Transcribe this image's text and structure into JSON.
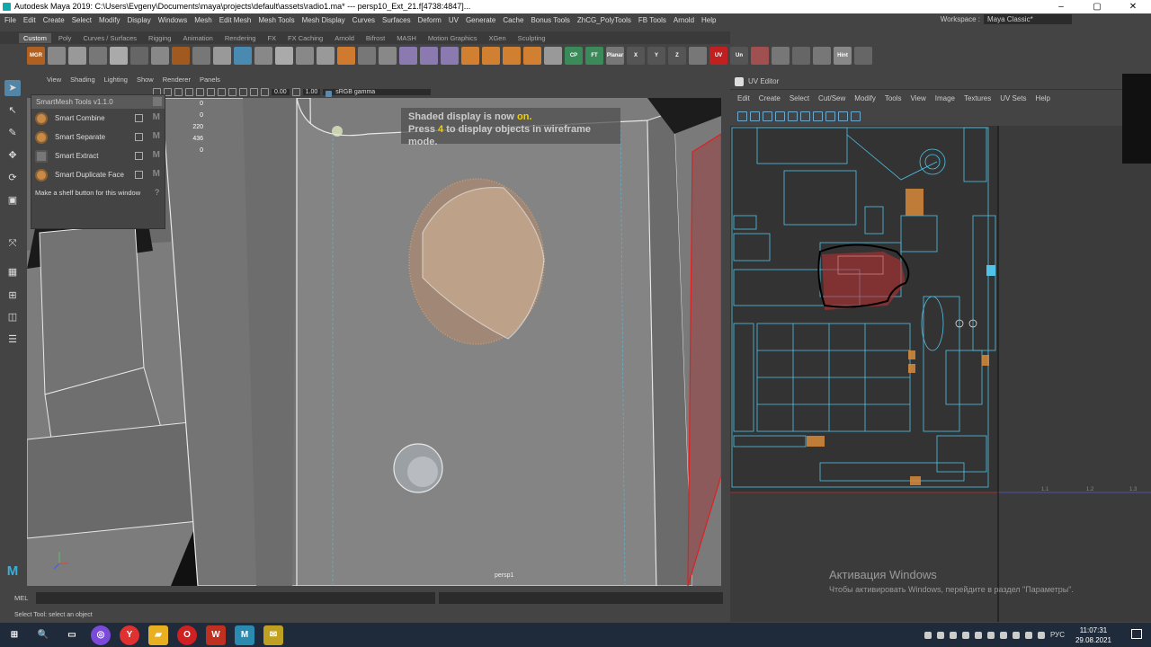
{
  "window": {
    "title": "Autodesk Maya 2019: C:\\Users\\Evgeny\\Documents\\maya\\projects\\default\\assets\\radio1.ma*  ---  persp10_Ext_21.f[4738:4847]...",
    "controls": [
      "–",
      "▢",
      "✕"
    ]
  },
  "main_menu": [
    "File",
    "Edit",
    "Create",
    "Select",
    "Modify",
    "Display",
    "Windows",
    "Mesh",
    "Edit Mesh",
    "Mesh Tools",
    "Mesh Display",
    "Curves",
    "Surfaces",
    "Deform",
    "UV",
    "Generate",
    "Cache",
    "Bonus Tools",
    "ZhCG_PolyTools",
    "FB Tools",
    "Arnold",
    "Help"
  ],
  "workspace": {
    "label": "Workspace :",
    "value": "Maya Classic*"
  },
  "shelf_tabs": [
    "Custom",
    "Poly",
    "Curves / Surfaces",
    "Rigging",
    "Animation",
    "Rendering",
    "FX",
    "FX Caching",
    "Arnold",
    "Bifrost",
    "MASH",
    "Motion Graphics",
    "XGen",
    "Sculpting"
  ],
  "shelf_buttons": [
    "MGR",
    "",
    "",
    "",
    "",
    "",
    "",
    "",
    "",
    "",
    "",
    "",
    "",
    "",
    "",
    "",
    "",
    "",
    "",
    "",
    "",
    "",
    "",
    "",
    "",
    "",
    "CP",
    "FT",
    "Planar",
    "X",
    "Y",
    "Z",
    "",
    "UV",
    "Un",
    "",
    "",
    "",
    "",
    "Hint",
    ""
  ],
  "viewport": {
    "menu": [
      "View",
      "Shading",
      "Lighting",
      "Show",
      "Renderer",
      "Panels"
    ],
    "toolbar": {
      "exposure": "0.00",
      "gamma": "1.00",
      "color_space": "sRGB gamma"
    },
    "hud_message": {
      "line1_pre": "Shaded display is now ",
      "line1_hl": "on.",
      "line2_pre": "Press ",
      "line2_hl": "4",
      "line2_post": " to display objects in wireframe mode."
    },
    "stats": [
      "0",
      "0",
      "220",
      "436",
      "0"
    ],
    "camera_label": "persp1"
  },
  "smartmesh": {
    "title": "SmartMesh Tools v1.1.0",
    "items": [
      "Smart Combine",
      "Smart Separate",
      "Smart Extract",
      "Smart Duplicate Face"
    ],
    "footer": "Make a shelf button for this window",
    "help": "?"
  },
  "cmdline": {
    "label": "MEL"
  },
  "helpline": {
    "text": "Select Tool: select an object"
  },
  "uv_editor": {
    "title": "UV Editor",
    "menu": [
      "Edit",
      "Create",
      "Select",
      "Cut/Sew",
      "Modify",
      "Tools",
      "View",
      "Image",
      "Textures",
      "UV Sets",
      "Help"
    ],
    "grid_labels": [
      "1.1",
      "1.2",
      "1.3"
    ]
  },
  "watermark": {
    "line1": "Активация Windows",
    "line2": "Чтобы активировать Windows, перейдите в раздел \"Параметры\"."
  },
  "taskbar": {
    "apps": [
      "⊞",
      "🔍",
      "▭",
      "◎",
      "Y",
      "▰",
      "O",
      "W",
      "M",
      "✉"
    ],
    "lang": "РУС",
    "time": "11:07:31",
    "date": "29.08.2021"
  },
  "colors": {
    "accent": "#5285a6",
    "uv_line": "#4fc3e8",
    "uv_orange": "#d88a3a",
    "highlight": "#f0d000"
  }
}
